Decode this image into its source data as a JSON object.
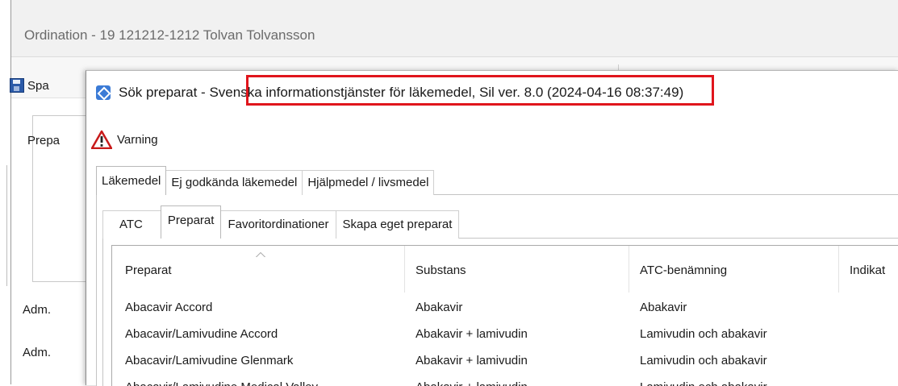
{
  "parent_window": {
    "title": "Ordination - 19 121212-1212 Tolvan Tolvansson",
    "toolbar_save_label": "Spa",
    "group_label": "Prepa",
    "adm_label_1": "Adm.",
    "adm_label_2": "Adm."
  },
  "dialog": {
    "title_prefix": "Sök preparat - ",
    "title_highlighted": "Svenska informationstjänster för läkemedel, Sil ver. 8.0",
    "title_suffix": " (2024-04-16 08:37:49)",
    "highlight_color": "#e0151c",
    "warning_label": "Varning",
    "tabs_top": [
      {
        "label": "Läkemedel",
        "active": true
      },
      {
        "label": "Ej godkända läkemedel",
        "active": false
      },
      {
        "label": "Hjälpmedel / livsmedel",
        "active": false
      }
    ],
    "tabs_inner": [
      {
        "label": "ATC",
        "active": false
      },
      {
        "label": "Preparat",
        "active": true
      },
      {
        "label": "Favoritordinationer",
        "active": false
      },
      {
        "label": "Skapa eget preparat",
        "active": false
      }
    ],
    "table": {
      "columns": [
        "Preparat",
        "Substans",
        "ATC-benämning",
        "Indikat"
      ],
      "rows": [
        [
          "Abacavir Accord",
          "Abakavir",
          "Abakavir",
          ""
        ],
        [
          "Abacavir/Lamivudine Accord",
          "Abakavir + lamivudin",
          "Lamivudin och abakavir",
          ""
        ],
        [
          "Abacavir/Lamivudine Glenmark",
          "Abakavir + lamivudin",
          "Lamivudin och abakavir",
          ""
        ],
        [
          "Abacavir/Lamivudine Medical Valley",
          "Abakavir + lamivudin",
          "Lamivudin och abakavir",
          ""
        ]
      ]
    }
  }
}
